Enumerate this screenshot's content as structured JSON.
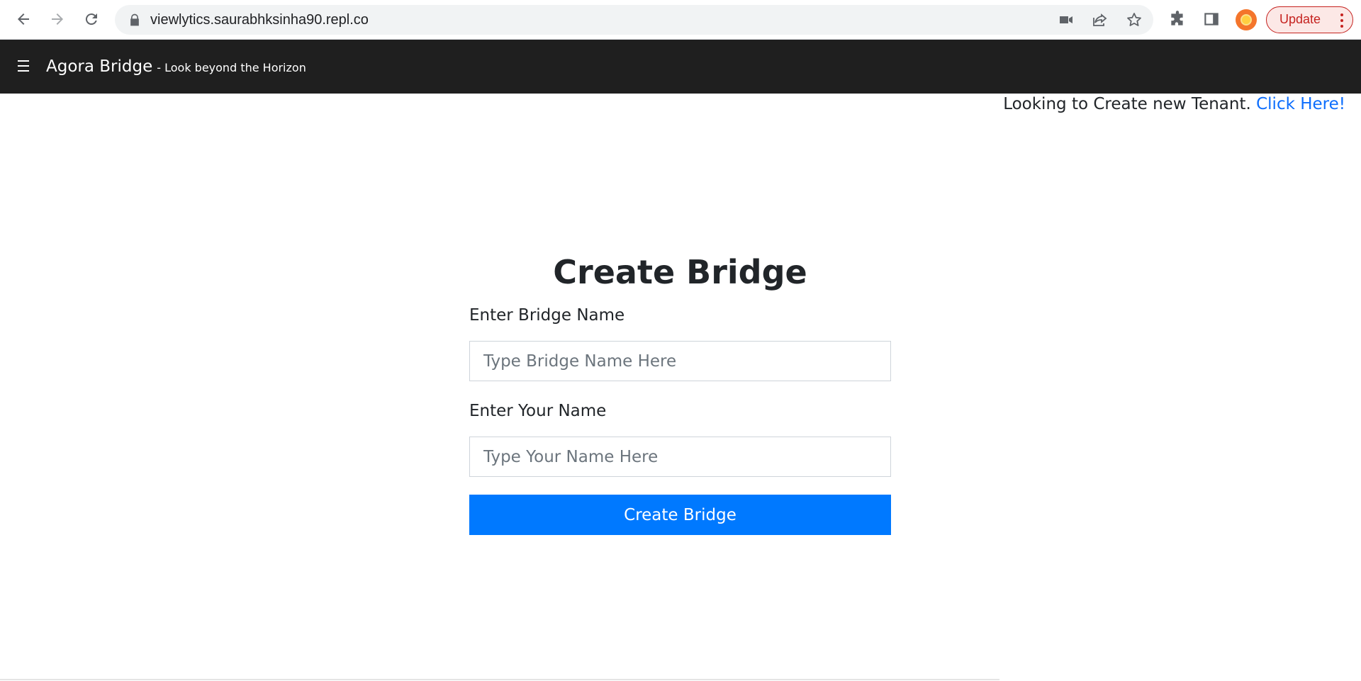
{
  "browser": {
    "url": "viewlytics.saurabhksinha90.repl.co",
    "update_label": "Update",
    "icons": {
      "back": "arrow-left-icon",
      "forward": "arrow-right-icon",
      "reload": "reload-icon",
      "lock": "lock-icon",
      "camera": "video-camera-icon",
      "share": "share-icon",
      "bookmark": "star-icon",
      "extensions": "puzzle-icon",
      "side_panel": "side-panel-icon",
      "profile": "profile-avatar-icon",
      "menu": "kebab-menu-icon"
    },
    "colors": {
      "update_text": "#c5221f",
      "update_bg": "#fce8e6"
    }
  },
  "header": {
    "menu_icon": "hamburger-icon",
    "title": "Agora Bridge",
    "tagline": "- Look beyond the Horizon",
    "background": "#1f1f1f"
  },
  "tenant": {
    "prompt": "Looking to Create new Tenant. ",
    "link_label": "Click Here!",
    "link_color": "#0d6efd"
  },
  "form": {
    "title": "Create Bridge",
    "bridge_name_label": "Enter Bridge Name",
    "bridge_name_value": "",
    "bridge_name_placeholder": "Type Bridge Name Here",
    "your_name_label": "Enter Your Name",
    "your_name_value": "",
    "your_name_placeholder": "Type Your Name Here",
    "submit_label": "Create Bridge",
    "submit_color": "#0079ff"
  }
}
